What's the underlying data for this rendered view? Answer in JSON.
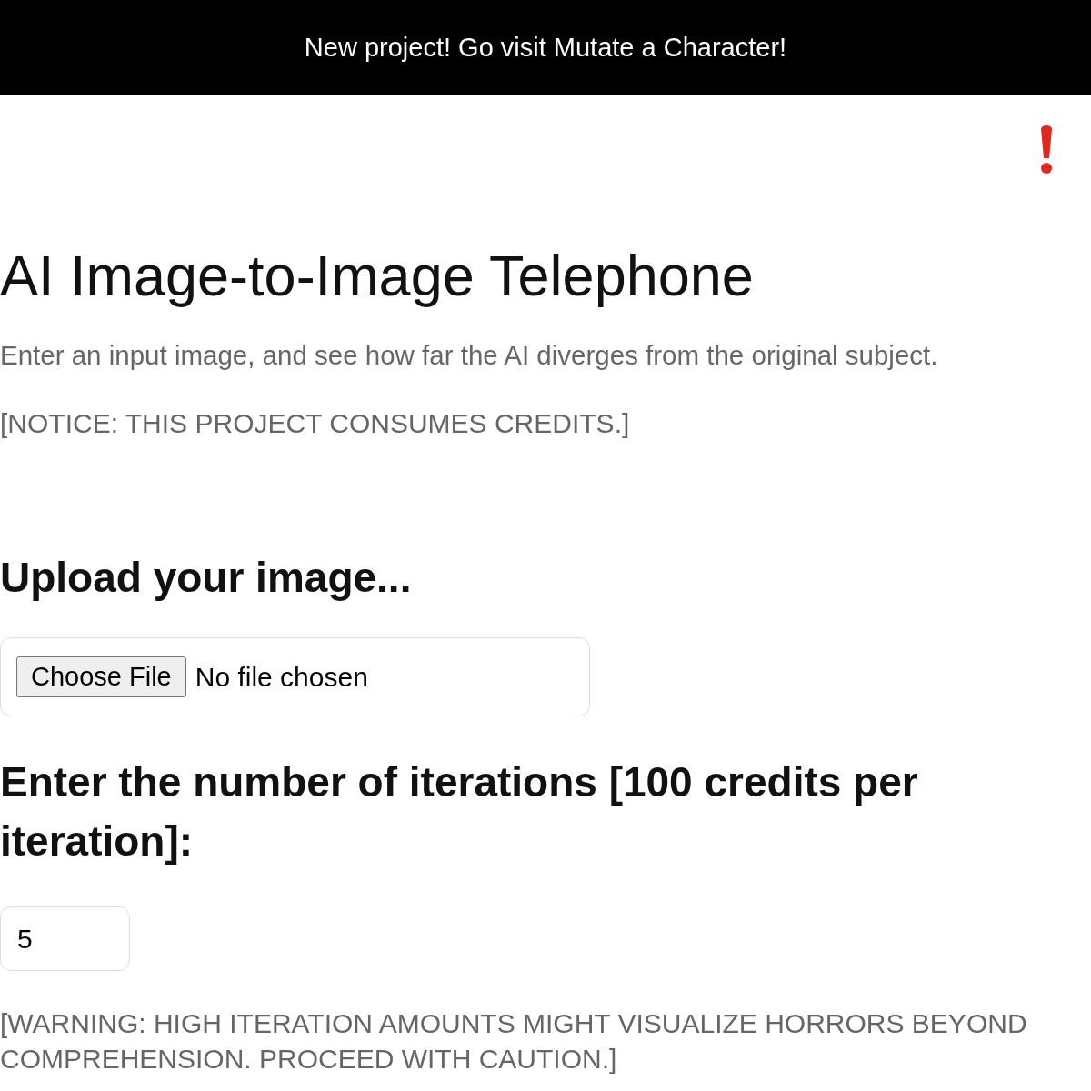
{
  "banner": {
    "text": "New project! Go visit Mutate a Character!"
  },
  "title": "AI Image-to-Image Telephone",
  "description": "Enter an input image, and see how far the AI diverges from the original subject.",
  "notice": "[NOTICE: THIS PROJECT CONSUMES CREDITS.]",
  "upload": {
    "heading": "Upload your image...",
    "button": "Choose File",
    "status": "No file chosen"
  },
  "iterations": {
    "heading": "Enter the number of iterations [100 credits per iteration]:",
    "value": "5"
  },
  "warning": "[WARNING: HIGH ITERATION AMOUNTS MIGHT VISUALIZE HORRORS BEYOND COMPREHENSION. PROCEED WITH CAUTION.]"
}
